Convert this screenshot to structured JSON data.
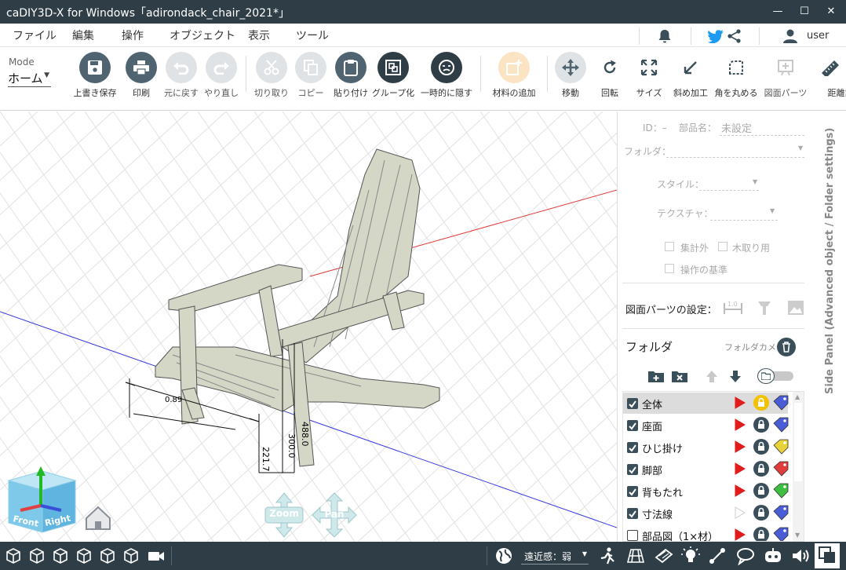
{
  "window": {
    "title": "caDIY3D-X for Windows「adirondack_chair_2021*」",
    "minimize": "—",
    "maximize": "☐",
    "close": "✕"
  },
  "menu": {
    "items": [
      "ファイル",
      "編集",
      "操作",
      "オブジェクト",
      "表示",
      "ツール"
    ],
    "user": "user"
  },
  "toolbar": {
    "mode_label": "Mode",
    "mode_value": "ホーム",
    "tools": [
      {
        "name": "save",
        "label": "上書き保存"
      },
      {
        "name": "print",
        "label": "印刷"
      },
      {
        "name": "undo",
        "label": "元に戻す"
      },
      {
        "name": "redo",
        "label": "やり直し"
      },
      {
        "name": "cut",
        "label": "切り取り"
      },
      {
        "name": "copy",
        "label": "コピー"
      },
      {
        "name": "paste",
        "label": "貼り付け"
      },
      {
        "name": "group",
        "label": "グループ化"
      },
      {
        "name": "hide",
        "label": "一時的に隠す"
      },
      {
        "name": "add-material",
        "label": "材料の追加"
      },
      {
        "name": "move",
        "label": "移動"
      },
      {
        "name": "rotate",
        "label": "回転"
      },
      {
        "name": "size",
        "label": "サイズ"
      },
      {
        "name": "bevel",
        "label": "斜め加工"
      },
      {
        "name": "round",
        "label": "角を丸める"
      },
      {
        "name": "drawing-parts",
        "label": "図面パーツ"
      },
      {
        "name": "distance",
        "label": "距離計"
      }
    ]
  },
  "viewport": {
    "dimensions": [
      "488.0",
      "300.0",
      "221.7",
      "0.89"
    ],
    "cube_labels": {
      "front": "Front",
      "right": "Right"
    },
    "nav": {
      "zoom": "Zoom",
      "pan": "Pan"
    }
  },
  "side_panel": {
    "id_label": "ID：–",
    "part_name_label": "部品名：",
    "part_name_value": "未設定",
    "folder_label": "フォルダ：",
    "style_label": "スタイル：",
    "texture_label": "テクスチャ：",
    "checkboxes": [
      "集計外",
      "木取り用",
      "操作の基準"
    ],
    "drawing_parts_label": "図面パーツの設定：",
    "folder_title": "フォルダ",
    "folder_camera": "フォルダカメラ",
    "folders": [
      {
        "name": "全体",
        "checked": true,
        "visible": true,
        "lock_color": "#f2c200",
        "tag_color": "#4a5bd6"
      },
      {
        "name": "座面",
        "checked": true,
        "visible": true,
        "lock_color": "#3b4f5a",
        "tag_color": "#4a5bd6"
      },
      {
        "name": "ひじ掛け",
        "checked": true,
        "visible": true,
        "lock_color": "#3b4f5a",
        "tag_color": "#e8d23a"
      },
      {
        "name": "脚部",
        "checked": true,
        "visible": true,
        "lock_color": "#3b4f5a",
        "tag_color": "#e23b3b"
      },
      {
        "name": "背もたれ",
        "checked": true,
        "visible": true,
        "lock_color": "#3b4f5a",
        "tag_color": "#3fbf3f"
      },
      {
        "name": "寸法線",
        "checked": true,
        "visible": false,
        "lock_color": "#3b4f5a",
        "tag_color": "#4a5bd6"
      },
      {
        "name": "部品図（1×材）",
        "checked": false,
        "visible": true,
        "lock_color": "#3b4f5a",
        "tag_color": "#4a5bd6"
      }
    ],
    "vertical_tab": "Side Panel (Advanced object / Folder settings)"
  },
  "statusbar": {
    "perspective": "遠近感：弱"
  },
  "colors": {
    "titlebar": "#2f3e46",
    "accent": "#4f6470",
    "wood": "#d4d6c6"
  }
}
